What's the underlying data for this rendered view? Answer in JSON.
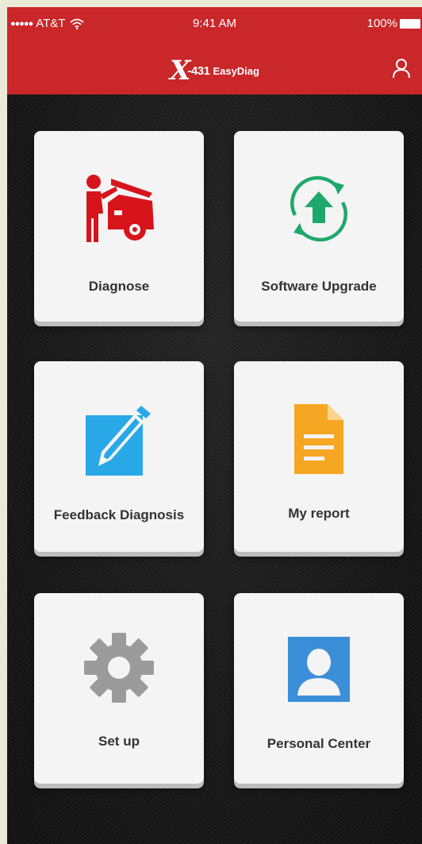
{
  "status_bar": {
    "signal": "●●●●●",
    "carrier": "AT&T",
    "time": "9:41 AM",
    "battery": "100%"
  },
  "header": {
    "logo_x": "X",
    "logo_number": "-431",
    "logo_name": "EasyDiag"
  },
  "tiles": [
    {
      "label": "Diagnose",
      "icon": "mechanic-car-icon",
      "color": "#d7141b"
    },
    {
      "label": "Software Upgrade",
      "icon": "upgrade-arrows-icon",
      "color": "#1fa86b"
    },
    {
      "label": "Feedback Diagnosis",
      "icon": "pencil-edit-icon",
      "color": "#29a8e8"
    },
    {
      "label": "My report",
      "icon": "document-icon",
      "color": "#f5a623"
    },
    {
      "label": "Set up",
      "icon": "gear-icon",
      "color": "#9b9b9b"
    },
    {
      "label": "Personal Center",
      "icon": "person-icon",
      "color": "#3b8fd9"
    }
  ],
  "colors": {
    "header": "#c9272a",
    "background": "#171717",
    "tile": "#f4f4f4"
  }
}
